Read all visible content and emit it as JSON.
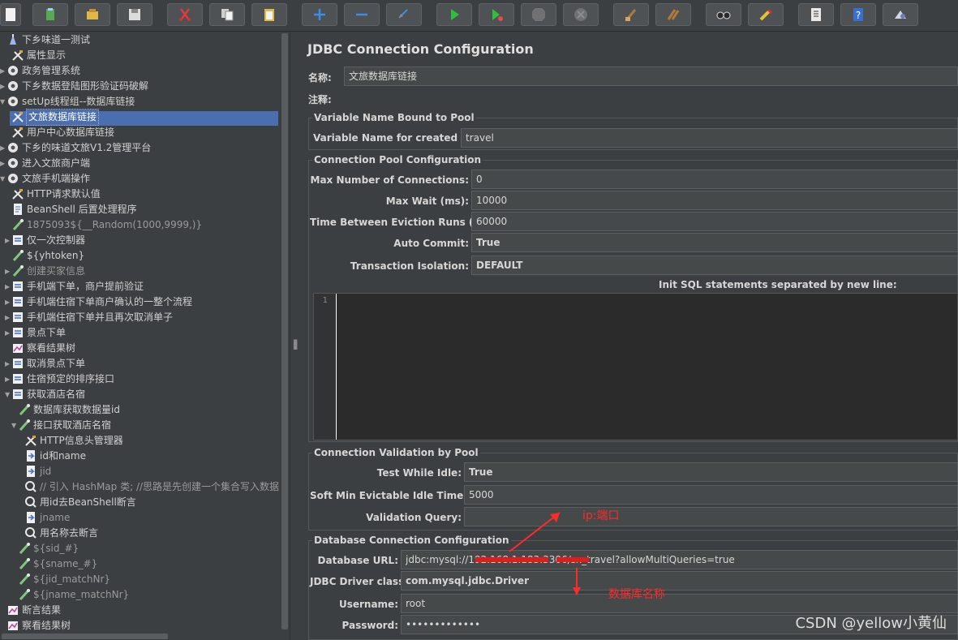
{
  "toolbar": {
    "buttons": [
      "new-icon",
      "templates-icon",
      "open-icon",
      "save-icon",
      "cut-icon",
      "copy-icon",
      "paste-icon",
      "expand-icon",
      "collapse-icon",
      "toggle-icon",
      "start-icon",
      "start-no-timers-icon",
      "stop-icon",
      "shutdown-icon",
      "clear-icon",
      "clear-all-icon",
      "search-icon",
      "reset-search-icon",
      "function-helper-icon",
      "help-icon",
      "remote-icon"
    ]
  },
  "tree": {
    "items": [
      {
        "label": "下乡味道一测试",
        "icon": "test-plan-icon"
      },
      {
        "label": "属性显示",
        "icon": "config-icon"
      },
      {
        "label": "政务管理系统",
        "icon": "thread-group-icon"
      },
      {
        "label": "下乡数据登陆图形验证码破解",
        "icon": "thread-group-icon"
      },
      {
        "label": "setUp线程组--数据库链接",
        "icon": "thread-group-icon"
      },
      {
        "label": "文旅数据库链接",
        "icon": "config-icon"
      },
      {
        "label": "用户中心数据库链接",
        "icon": "config-icon"
      },
      {
        "label": "下乡的味道文旅V1.2管理平台",
        "icon": "thread-group-icon"
      },
      {
        "label": "进入文旅商户端",
        "icon": "thread-group-icon"
      },
      {
        "label": "文旅手机端操作",
        "icon": "thread-group-icon"
      },
      {
        "label": "HTTP请求默认值",
        "icon": "config-icon"
      },
      {
        "label": "BeanShell 后置处理程序",
        "icon": "script-icon"
      },
      {
        "label": "1875093${__Random(1000,9999,)}",
        "icon": "sampler-icon"
      },
      {
        "label": "仅一次控制器",
        "icon": "controller-icon"
      },
      {
        "label": "${yhtoken}",
        "icon": "sampler-icon"
      },
      {
        "label": "创建买家信息",
        "icon": "sampler-icon"
      },
      {
        "label": "手机端下单，商户提前验证",
        "icon": "controller-icon"
      },
      {
        "label": "手机端住宿下单商户确认的一整个流程",
        "icon": "controller-icon"
      },
      {
        "label": "手机端住宿下单并且再次取消单子",
        "icon": "controller-icon"
      },
      {
        "label": "景点下单",
        "icon": "controller-icon"
      },
      {
        "label": "察看结果树",
        "icon": "listener-icon"
      },
      {
        "label": "取消景点下单",
        "icon": "controller-icon"
      },
      {
        "label": "住宿预定的排序接口",
        "icon": "controller-icon"
      },
      {
        "label": "获取酒店名宿",
        "icon": "controller-icon"
      },
      {
        "label": "数据库获取数据量id",
        "icon": "sampler-icon"
      },
      {
        "label": "接口获取酒店名宿",
        "icon": "sampler-icon"
      },
      {
        "label": "HTTP信息头管理器",
        "icon": "config-icon"
      },
      {
        "label": "id和name",
        "icon": "extractor-icon"
      },
      {
        "label": "jid",
        "icon": "extractor-icon"
      },
      {
        "label": "// 引入 HashMap 类; //思路是先创建一个集合写入数据{",
        "icon": "assertion-icon"
      },
      {
        "label": "用id去BeanShell断言",
        "icon": "assertion-icon"
      },
      {
        "label": "jname",
        "icon": "extractor-icon"
      },
      {
        "label": "用名称去断言",
        "icon": "assertion-icon"
      },
      {
        "label": "${sid_#}",
        "icon": "sampler-icon"
      },
      {
        "label": "${sname_#}",
        "icon": "sampler-icon"
      },
      {
        "label": "${jid_matchNr}",
        "icon": "sampler-icon"
      },
      {
        "label": "${jname_matchNr}",
        "icon": "sampler-icon"
      },
      {
        "label": "断言结果",
        "icon": "listener-icon"
      },
      {
        "label": "察看结果树",
        "icon": "listener-icon"
      }
    ]
  },
  "panel": {
    "title": "JDBC Connection Configuration",
    "name_label": "名称:",
    "name_value": "文旅数据库链接",
    "comment_label": "注释:",
    "comment_value": "",
    "var_group_title": "Variable Name Bound to Pool",
    "var_label": "Variable Name for created pool:",
    "var_value": "travel",
    "pool_group_title": "Connection Pool Configuration",
    "max_conn_label": "Max Number of Connections:",
    "max_conn_value": "0",
    "max_wait_label": "Max Wait (ms):",
    "max_wait_value": "10000",
    "eviction_label": "Time Between Eviction Runs (ms):",
    "eviction_value": "60000",
    "auto_commit_label": "Auto Commit:",
    "auto_commit_value": "True",
    "isolation_label": "Transaction Isolation:",
    "isolation_value": "DEFAULT",
    "init_sql_label": "Init SQL statements separated by new line:",
    "init_sql_line_no": "1",
    "validation_group_title": "Connection Validation by Pool",
    "test_idle_label": "Test While Idle:",
    "test_idle_value": "True",
    "soft_min_label": "Soft Min Evictable Idle Time(ms):",
    "soft_min_value": "5000",
    "val_query_label": "Validation Query:",
    "val_query_value": "",
    "db_group_title": "Database Connection Configuration",
    "url_label": "Database URL:",
    "url_value": "jdbc:mysql://192.168.1.183:3306/sx_travel?allowMultiQueries=true",
    "driver_label": "JDBC Driver class:",
    "driver_value": "com.mysql.jdbc.Driver",
    "user_label": "Username:",
    "user_value": "root",
    "pass_label": "Password:",
    "pass_value": "•••••••••••••"
  },
  "annotations": {
    "ip_port": "ip:端口",
    "db_name": "数据库名称",
    "color": "#ff2a2a"
  },
  "watermark": "CSDN @yellow小黄仙",
  "colors": {
    "selection": "#4b6eaf",
    "background": "#3c3f41"
  }
}
